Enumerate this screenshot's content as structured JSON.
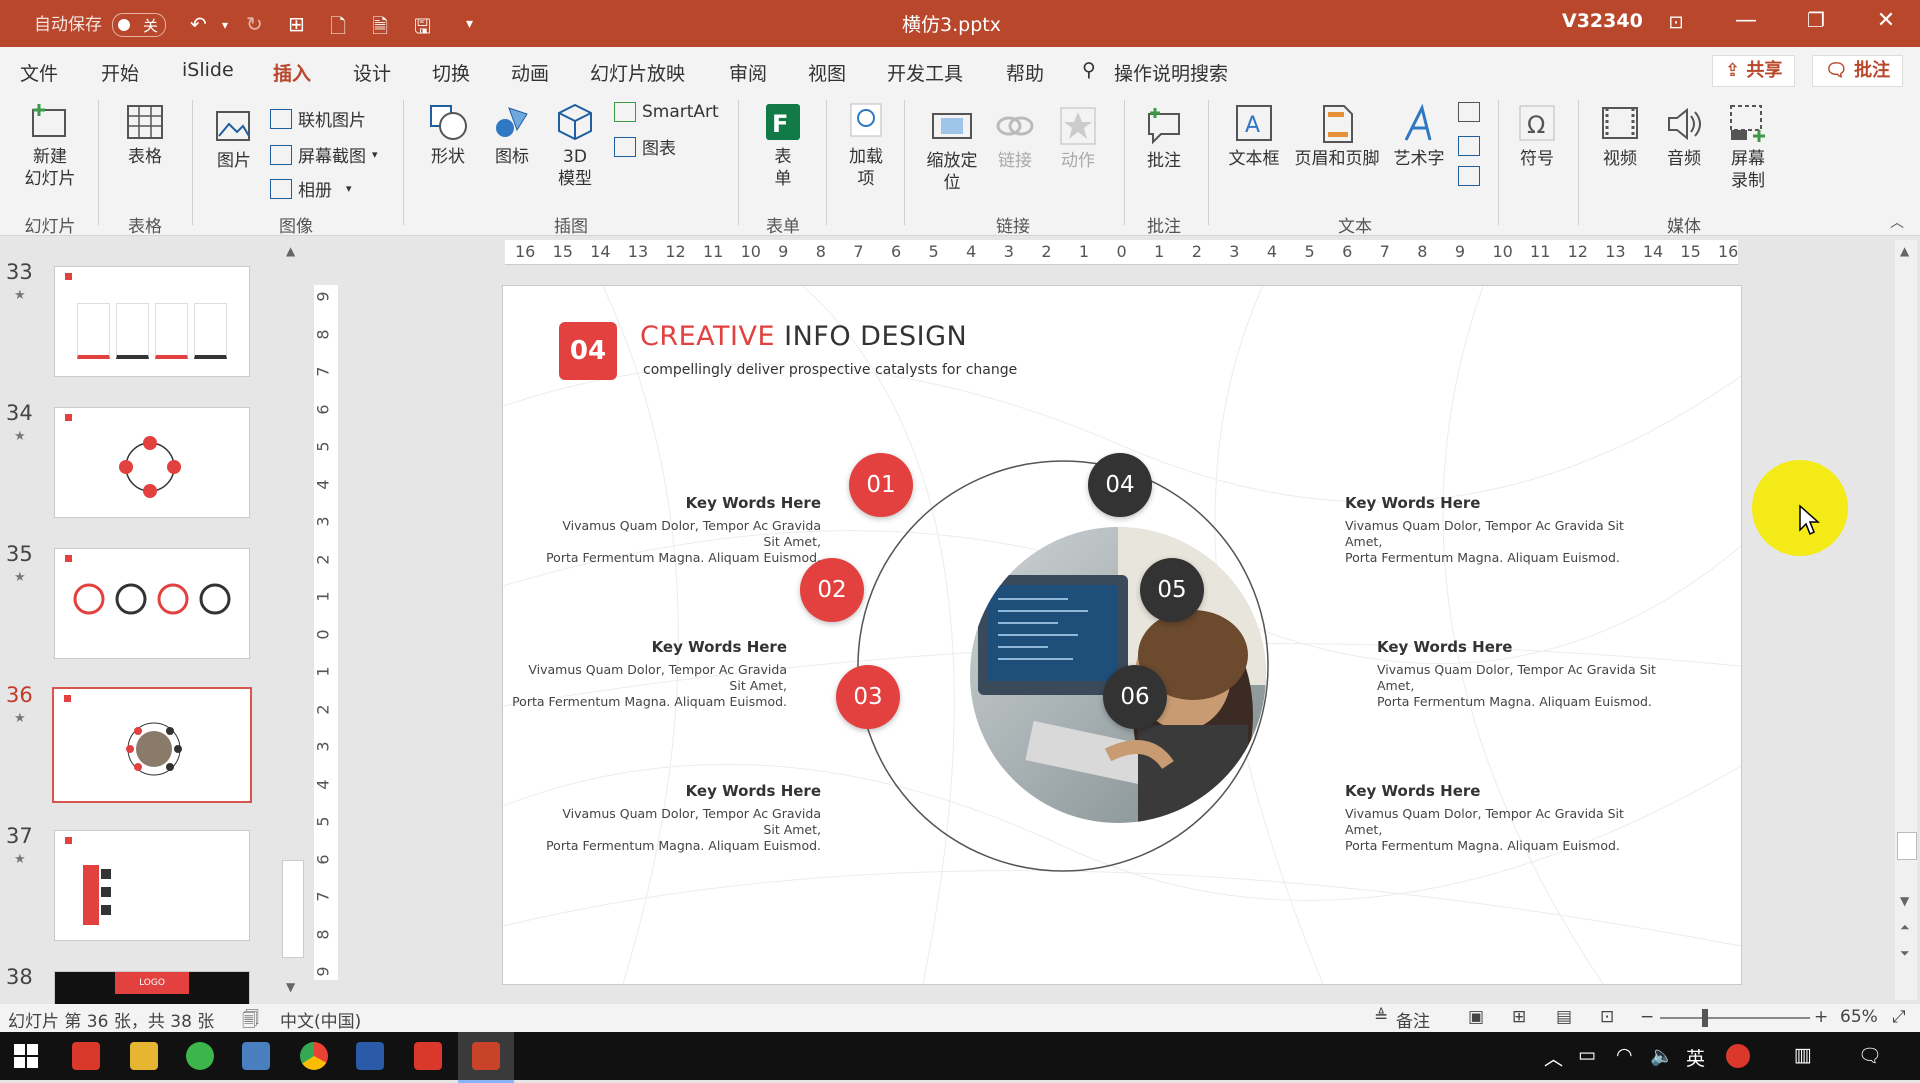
{
  "titlebar": {
    "autosave_label": "自动保存",
    "autosave_state": "关",
    "file_name": "横仿3.pptx",
    "user": "V32340"
  },
  "menu": {
    "tabs": [
      "文件",
      "开始",
      "iSlide",
      "插入",
      "设计",
      "切换",
      "动画",
      "幻灯片放映",
      "审阅",
      "视图",
      "开发工具",
      "帮助"
    ],
    "active_tab": "插入",
    "search_label": "操作说明搜索",
    "share_label": "共享",
    "comment_label": "批注"
  },
  "ribbon": {
    "new_slide": "新建\n幻灯片",
    "table": "表格",
    "picture": "图片",
    "online_pictures": "联机图片",
    "screenshot": "屏幕截图",
    "album": "相册",
    "shapes": "形状",
    "icons": "图标",
    "model3d": "3D\n模型",
    "smartart": "SmartArt",
    "chart": "图表",
    "forms": "表\n单",
    "addins": "加载\n项",
    "zoom": "缩放定\n位",
    "link": "链接",
    "action": "动作",
    "comment": "批注",
    "textbox": "文本框",
    "header_footer": "页眉和页脚",
    "wordart": "艺术字",
    "symbol": "符号",
    "video": "视频",
    "audio": "音频",
    "screen_record": "屏幕\n录制",
    "groups": {
      "slides": "幻灯片",
      "tables": "表格",
      "images": "图像",
      "illustrations": "插图",
      "forms": "表单",
      "links": "链接",
      "comments": "批注",
      "text": "文本",
      "media": "媒体"
    }
  },
  "thumbnails": {
    "items": [
      {
        "num": "33"
      },
      {
        "num": "34"
      },
      {
        "num": "35"
      },
      {
        "num": "36"
      },
      {
        "num": "37"
      },
      {
        "num": "38",
        "logo": "LOGO"
      }
    ]
  },
  "ruler": {
    "h_ticks": [
      "16",
      "15",
      "14",
      "13",
      "12",
      "11",
      "10",
      "9",
      "8",
      "7",
      "6",
      "5",
      "4",
      "3",
      "2",
      "1",
      "0",
      "1",
      "2",
      "3",
      "4",
      "5",
      "6",
      "7",
      "8",
      "9",
      "10",
      "11",
      "12",
      "13",
      "14",
      "15",
      "16"
    ],
    "v_ticks": [
      "9",
      "8",
      "7",
      "6",
      "5",
      "4",
      "3",
      "2",
      "1",
      "0",
      "1",
      "2",
      "3",
      "4",
      "5",
      "6",
      "7",
      "8",
      "9"
    ]
  },
  "slide": {
    "badge": "04",
    "title_accent": "CREATIVE",
    "title_rest": "INFO DESIGN",
    "subtitle": "compellingly deliver prospective catalysts for change",
    "items": [
      {
        "num": "01",
        "title": "Key Words Here",
        "line1": "Vivamus Quam Dolor, Tempor Ac Gravida Sit Amet,",
        "line2": "Porta Fermentum Magna. Aliquam Euismod."
      },
      {
        "num": "02",
        "title": "Key Words Here",
        "line1": "Vivamus Quam Dolor, Tempor Ac Gravida Sit Amet,",
        "line2": "Porta Fermentum Magna. Aliquam Euismod."
      },
      {
        "num": "03",
        "title": "Key Words Here",
        "line1": "Vivamus Quam Dolor, Tempor Ac Gravida Sit Amet,",
        "line2": "Porta Fermentum Magna. Aliquam Euismod."
      },
      {
        "num": "04",
        "title": "Key Words Here",
        "line1": "Vivamus Quam Dolor, Tempor Ac Gravida Sit Amet,",
        "line2": "Porta Fermentum Magna. Aliquam Euismod."
      },
      {
        "num": "05",
        "title": "Key Words Here",
        "line1": "Vivamus Quam Dolor, Tempor Ac Gravida Sit Amet,",
        "line2": "Porta Fermentum Magna. Aliquam Euismod."
      },
      {
        "num": "06",
        "title": "Key Words Here",
        "line1": "Vivamus Quam Dolor, Tempor Ac Gravida Sit Amet,",
        "line2": "Porta Fermentum Magna. Aliquam Euismod."
      }
    ]
  },
  "status": {
    "slide_info": "幻灯片 第 36 张，共 38 张",
    "language": "中文(中国)",
    "notes": "备注",
    "zoom": "65%"
  },
  "taskbar": {
    "ime": "英"
  },
  "colors": {
    "accent": "#b9472b",
    "slide_red": "#e2413f",
    "slide_dark": "#333333",
    "cursor_highlight": "#f5ea00"
  }
}
